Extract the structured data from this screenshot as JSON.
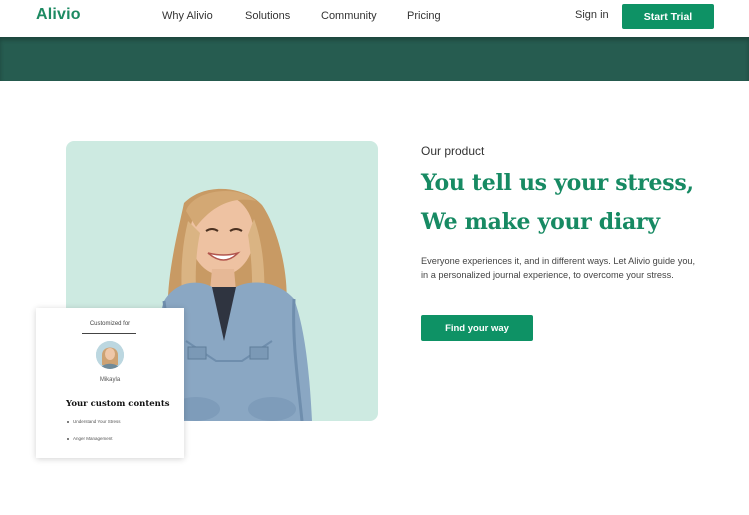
{
  "nav": {
    "logo": "Alivio",
    "links": [
      "Why Alivio",
      "Solutions",
      "Community",
      "Pricing"
    ],
    "sign_in": "Sign in",
    "start_trial": "Start Trial"
  },
  "hero": {
    "eyebrow": "Our product",
    "headline_line1": "You tell us your stress,",
    "headline_line2": "We make your diary",
    "description": "Everyone experiences it, and in different ways. Let Alivio guide you, in a personalized journal experience, to overcome your stress.",
    "cta": "Find your way"
  },
  "card": {
    "customized_for": "Customized for",
    "name": "Mikayla",
    "title": "Your custom contents",
    "items": [
      "Understand Your Stress",
      "Anger Management"
    ]
  },
  "colors": {
    "brand_green": "#0e9265",
    "headline_green": "#178a63",
    "band_dark_green": "#265c50",
    "photo_bg_mint": "#cdeae1"
  }
}
